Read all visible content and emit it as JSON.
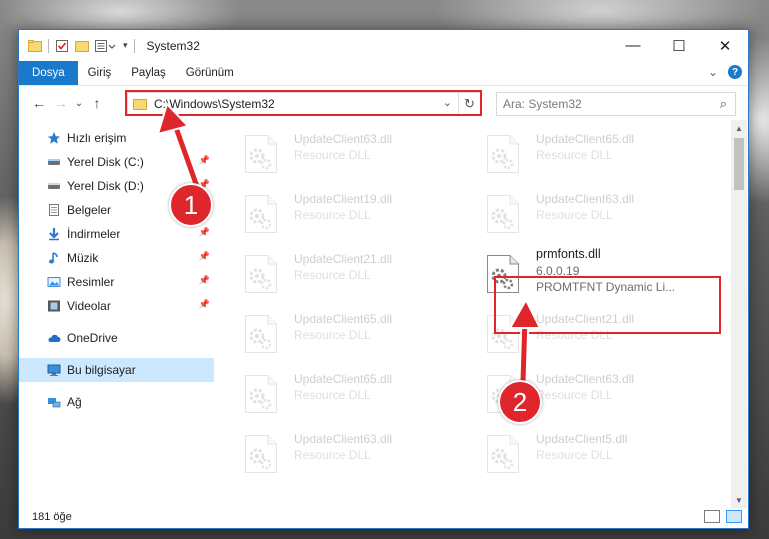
{
  "window": {
    "title": "System32"
  },
  "ribbon": {
    "tabs": [
      "Dosya",
      "Giriş",
      "Paylaş",
      "Görünüm"
    ],
    "help_label": "?",
    "collapse_glyph": "⌄"
  },
  "window_controls": {
    "minimize": "—",
    "maximize": "☐",
    "close": "✕"
  },
  "navigation": {
    "back_glyph": "←",
    "forward_glyph": "→",
    "recent_glyph": "⌄",
    "up_glyph": "↑",
    "address_path": "C:\\Windows\\System32",
    "address_dropdown_glyph": "⌄",
    "refresh_glyph": "↻",
    "search_placeholder": "Ara: System32",
    "search_glyph": "⌕"
  },
  "sidebar": {
    "quick_access": "Hızlı erişim",
    "items": [
      {
        "label": "Yerel Disk (C:)",
        "icon": "drive-icon",
        "pinned": true
      },
      {
        "label": "Yerel Disk (D:)",
        "icon": "drive-icon",
        "pinned": true
      },
      {
        "label": "Belgeler",
        "icon": "documents-icon",
        "pinned": true
      },
      {
        "label": "İndirmeler",
        "icon": "downloads-icon",
        "pinned": true
      },
      {
        "label": "Müzik",
        "icon": "music-icon",
        "pinned": true
      },
      {
        "label": "Resimler",
        "icon": "pictures-icon",
        "pinned": true
      },
      {
        "label": "Videolar",
        "icon": "videos-icon",
        "pinned": true
      }
    ],
    "onedrive": "OneDrive",
    "this_pc": "Bu bilgisayar",
    "network": "Ağ",
    "pin_glyph": "📌"
  },
  "files": [
    {
      "name": "UpdateClient63.dll",
      "desc": "Resource DLL",
      "ghost": true
    },
    {
      "name": "UpdateClient65.dll",
      "desc": "Resource DLL",
      "ghost": true
    },
    {
      "name": "UpdateClient19.dll",
      "desc": "Resource DLL",
      "ghost": true
    },
    {
      "name": "UpdateClient63.dll",
      "desc": "Resource DLL",
      "ghost": true
    },
    {
      "name": "UpdateClient21.dll",
      "desc": "Resource DLL",
      "ghost": true
    },
    {
      "name": "prmfonts.dll",
      "version": "6.0.0.19",
      "desc": "PROMTFNT Dynamic Li...",
      "ghost": false
    },
    {
      "name": "UpdateClient65.dll",
      "desc": "Resource DLL",
      "ghost": true
    },
    {
      "name": "UpdateClient21.dll",
      "desc": "Resource DLL",
      "ghost": true
    },
    {
      "name": "UpdateClient65.dll",
      "desc": "Resource DLL",
      "ghost": true
    },
    {
      "name": "UpdateClient63.dll",
      "desc": "Resource DLL",
      "ghost": true
    },
    {
      "name": "UpdateClient63.dll",
      "desc": "Resource DLL",
      "ghost": true
    },
    {
      "name": "UpdateClient5.dll",
      "desc": "Resource DLL",
      "ghost": true
    }
  ],
  "status": {
    "item_count": "181 öğe"
  },
  "annotations": {
    "step1": "1",
    "step2": "2",
    "highlight_color": "#e0262d"
  },
  "colors": {
    "accent": "#1979ca",
    "selection": "#cce8ff",
    "highlight": "#e0262d"
  }
}
